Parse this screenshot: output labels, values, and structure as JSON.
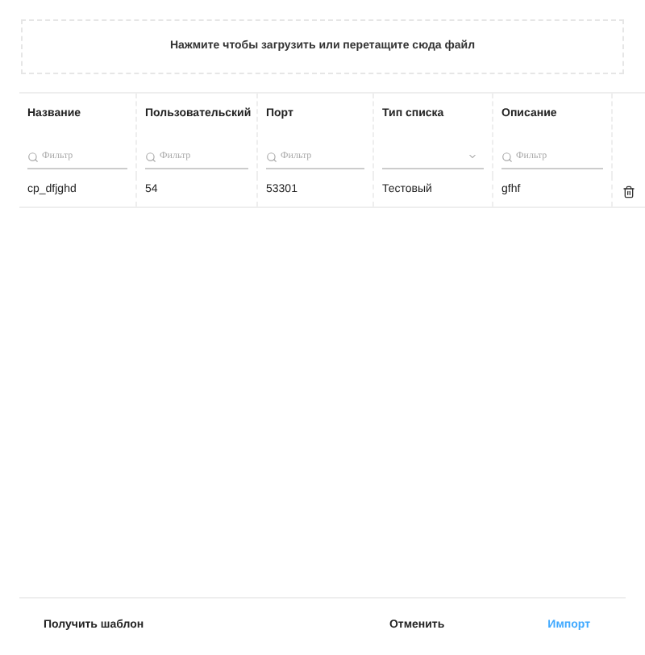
{
  "upload": {
    "text": "Нажмите чтобы загрузить или перетащите сюда файл"
  },
  "table": {
    "columns": [
      {
        "label": "Название",
        "filter": {
          "kind": "text",
          "placeholder": "Фильтр"
        }
      },
      {
        "label": "Пользовательский",
        "filter": {
          "kind": "text",
          "placeholder": "Фильтр"
        }
      },
      {
        "label": "Порт",
        "filter": {
          "kind": "text",
          "placeholder": "Фильтр"
        }
      },
      {
        "label": "Тип списка",
        "filter": {
          "kind": "select"
        }
      },
      {
        "label": "Описание",
        "filter": {
          "kind": "text",
          "placeholder": "Фильтр"
        }
      }
    ],
    "rows": [
      {
        "cells": [
          "cp_dfjghd",
          "54",
          "53301",
          "Тестовый",
          "gfhf"
        ]
      }
    ]
  },
  "footer": {
    "template_button": "Получить шаблон",
    "cancel_button": "Отменить",
    "import_button": "Импорт"
  }
}
